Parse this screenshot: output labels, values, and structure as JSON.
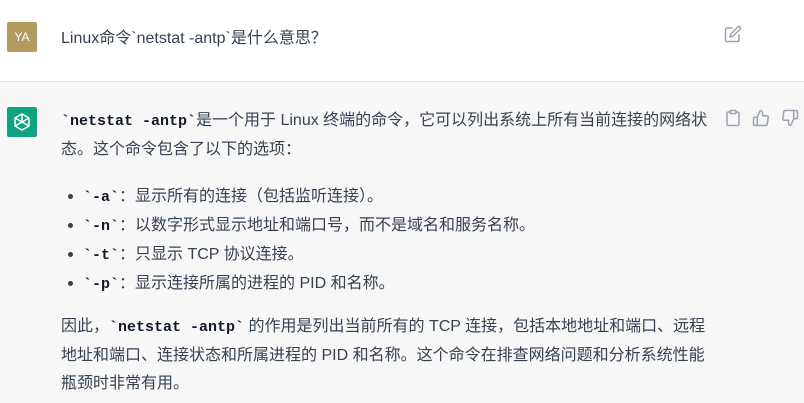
{
  "user_message": {
    "avatar_initials": "YA",
    "text": "Linux命令`netstat -antp`是什么意思？"
  },
  "assistant_message": {
    "intro_code": "`netstat -antp`",
    "intro_rest": "是一个用于 Linux 终端的命令，它可以列出系统上所有当前连接的网络状态。这个命令包含了以下的选项：",
    "options": [
      {
        "code": "`-a`",
        "text": "：显示所有的连接（包括监听连接）。"
      },
      {
        "code": "`-n`",
        "text": "：以数字形式显示地址和端口号，而不是域名和服务名称。"
      },
      {
        "code": "`-t`",
        "text": "：只显示 TCP 协议连接。"
      },
      {
        "code": "`-p`",
        "text": "：显示连接所属的进程的 PID 和名称。"
      }
    ],
    "summary_pre": "因此，",
    "summary_code": "`netstat -antp`",
    "summary_rest": " 的作用是列出当前所有的 TCP 连接，包括本地地址和端口、远程地址和端口、连接状态和所属进程的 PID 和名称。这个命令在排查网络问题和分析系统性能瓶颈时非常有用。"
  },
  "icons": {
    "edit": "edit-icon",
    "copy": "clipboard-icon",
    "thumbs_up": "thumbs-up-icon",
    "thumbs_down": "thumbs-down-icon",
    "assistant_logo": "openai-logo-icon"
  },
  "colors": {
    "user_avatar": "#b39a5e",
    "assistant_avatar": "#10a37f",
    "assistant_bg": "#f7f7f8"
  }
}
